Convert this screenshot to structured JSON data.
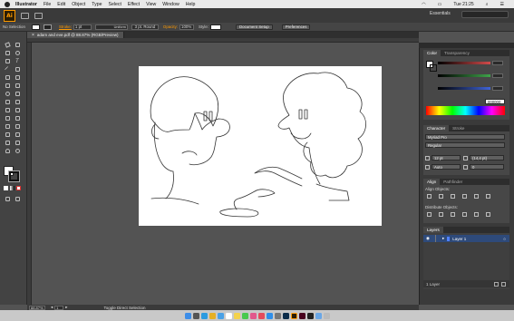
{
  "menubar": {
    "app": "Illustrator",
    "items": [
      "File",
      "Edit",
      "Object",
      "Type",
      "Select",
      "Effect",
      "View",
      "Window",
      "Help"
    ],
    "clock": "Tue 21:25"
  },
  "appbar": {
    "logo": "Ai",
    "workspace": "Essentials"
  },
  "control_bar": {
    "selection": "No Selection",
    "stroke_label": "Stroke:",
    "stroke_weight": "1 pt",
    "profile": "Uniform",
    "brush": "3 pt. Round",
    "opacity_label": "Opacity:",
    "opacity": "100%",
    "style_label": "Style:",
    "document_setup": "Document Setup",
    "preferences": "Preferences"
  },
  "document": {
    "tab_title": "adam and eve.pdf @ 88.87% (RGB/Preview)"
  },
  "status": {
    "zoom": "88.87%",
    "page": "1",
    "tool": "Toggle Direct Selection"
  },
  "color_panel": {
    "tabs": [
      "Color",
      "Transparency"
    ],
    "hex": "000000",
    "channel_colors": [
      "#d24b4b",
      "#3fa34a",
      "#3f63d6"
    ]
  },
  "character_panel": {
    "tabs": [
      "Character",
      "Stroke"
    ],
    "font": "Myriad Pro",
    "style": "Regular",
    "size": "12 pt",
    "leading": "(14,4 pt)",
    "tracking": "Auto",
    "kerning": "0"
  },
  "align_panel": {
    "tabs": [
      "Align",
      "Pathfinder"
    ],
    "align_objects": "Align Objects:",
    "distribute_objects": "Distribute Objects:"
  },
  "layers_panel": {
    "tab": "Layers",
    "layer_name": "Layer 1",
    "layer_color": "#4f80ff",
    "footer": "1 Layer"
  },
  "colors": {
    "accent": "#ff9a00",
    "selection": "#2e4a7a"
  }
}
